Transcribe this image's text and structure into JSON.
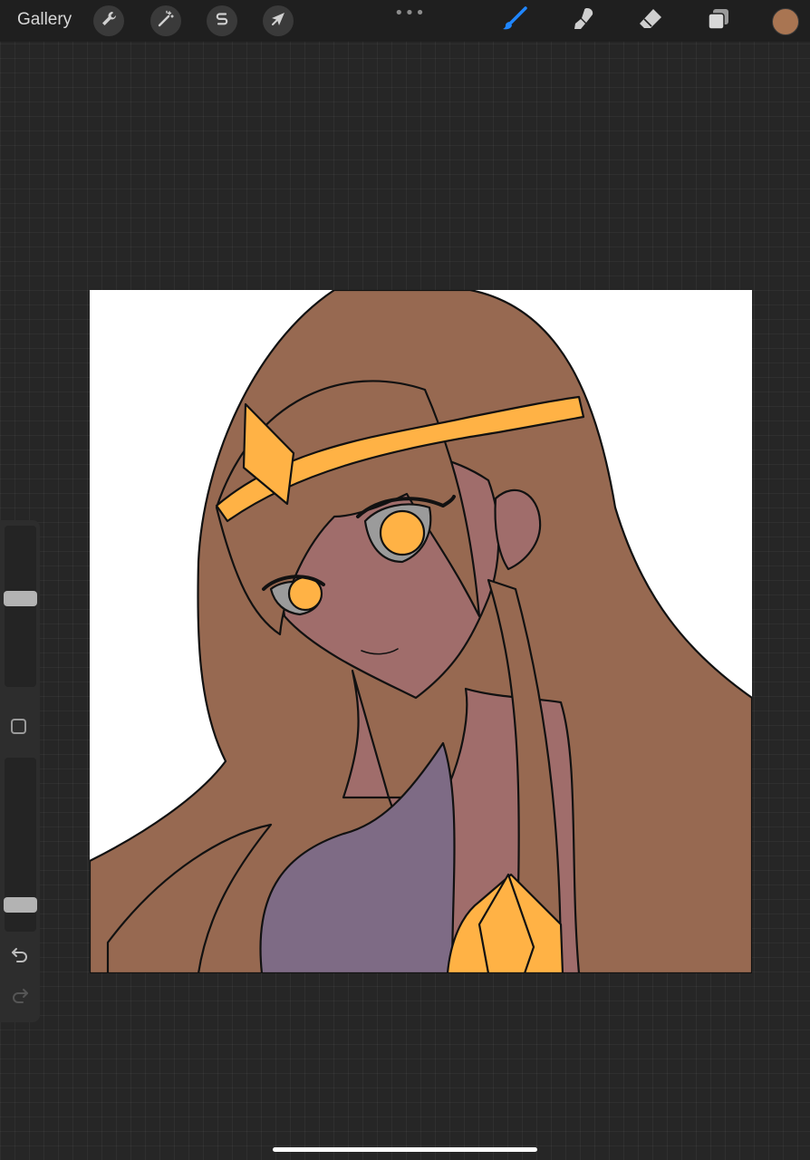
{
  "toolbar": {
    "gallery_label": "Gallery",
    "left_tools": [
      {
        "icon": "wrench-icon",
        "name": "actions"
      },
      {
        "icon": "magic-wand-icon",
        "name": "adjustments"
      },
      {
        "icon": "selection-s-icon",
        "name": "selection"
      },
      {
        "icon": "arrow-cursor-icon",
        "name": "transform"
      }
    ],
    "more_label": "•••",
    "right_tools": [
      {
        "icon": "brush-icon",
        "name": "paint",
        "active": true
      },
      {
        "icon": "smudge-icon",
        "name": "smudge"
      },
      {
        "icon": "eraser-icon",
        "name": "erase"
      },
      {
        "icon": "layers-icon",
        "name": "layers"
      }
    ],
    "current_color": "#a97552",
    "active_color": "#1f86ff"
  },
  "sidebar": {
    "brush_size_level": 0.55,
    "opacity_level": 0.12
  },
  "canvas": {
    "background": "#ffffff",
    "palette": {
      "hair": "#976951",
      "skin": "#a06d6b",
      "gold": "#ffb245",
      "dress": "#7e6b85",
      "eye_white": "#9b9b9b"
    }
  }
}
